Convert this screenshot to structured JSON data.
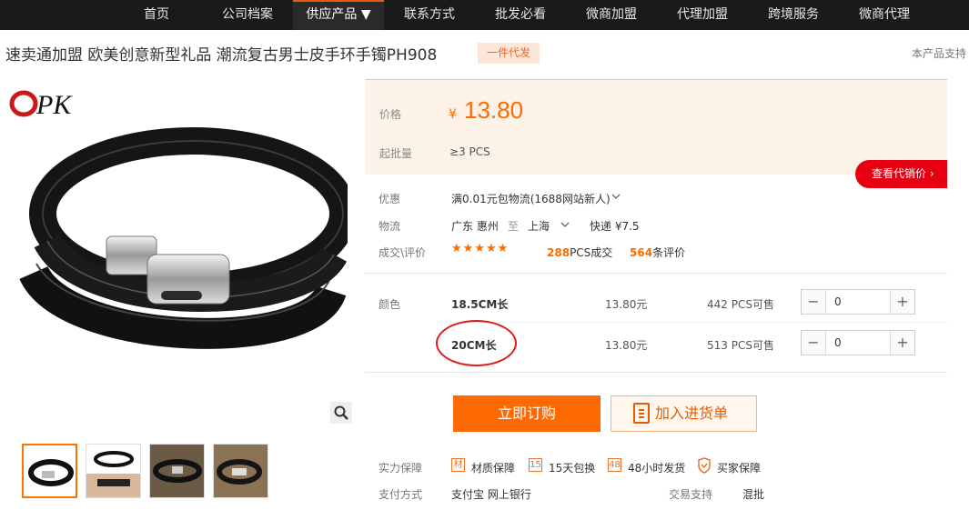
{
  "nav": {
    "items": [
      "首页",
      "公司档案",
      "供应产品 ▼",
      "联系方式",
      "批发必看",
      "微商加盟",
      "代理加盟",
      "跨境服务",
      "微商代理"
    ],
    "active_index": 2
  },
  "product": {
    "title": "速卖通加盟 欧美创意新型礼品 潮流复古男士皮手环手镯PH908",
    "badge": "一件代发",
    "support_text": "本产品支持"
  },
  "gallery": {
    "logo_text": "OPK",
    "thumb_count": 4
  },
  "price": {
    "price_label": "价格",
    "currency": "¥",
    "value": "13.80",
    "moq_label": "起批量",
    "moq_value": "≥3  PCS",
    "distributor_button": "查看代销价 ›"
  },
  "info": {
    "discount_label": "优惠",
    "discount_text": "满0.01元包物流(1688网站新人)",
    "logistics_label": "物流",
    "from": "广东 惠州",
    "to_word": "至",
    "to": "上海",
    "express": "快递 ¥7.5",
    "trade_label": "成交\\评价",
    "stars": "★★★★★",
    "deals_num": "288",
    "deals_text": "PCS成交",
    "reviews_num": "564",
    "reviews_text": "条评价"
  },
  "sku": {
    "label": "颜色",
    "rows": [
      {
        "name": "18.5CM长",
        "price": "13.80元",
        "stock": "442 PCS可售",
        "qty": "0"
      },
      {
        "name": "20CM长",
        "price": "13.80元",
        "stock": "513 PCS可售",
        "qty": "0"
      }
    ]
  },
  "actions": {
    "buy": "立即订购",
    "cart": "加入进货单"
  },
  "guarantee": {
    "label": "实力保障",
    "items": [
      {
        "icon": "材",
        "text": "材质保障"
      },
      {
        "icon": "15",
        "text": "15天包换"
      },
      {
        "icon": "48",
        "text": "48小时发货"
      },
      {
        "icon": "shield",
        "text": "买家保障"
      }
    ],
    "pay_label": "支付方式",
    "pay_methods": "支付宝   网上银行",
    "trade_support_label": "交易支持",
    "trade_support_value": "混批"
  },
  "colors": {
    "accent": "#ff6a00",
    "nav_bg": "#1a1a1a",
    "price_bg": "#fdf2e8",
    "red": "#e50012"
  }
}
